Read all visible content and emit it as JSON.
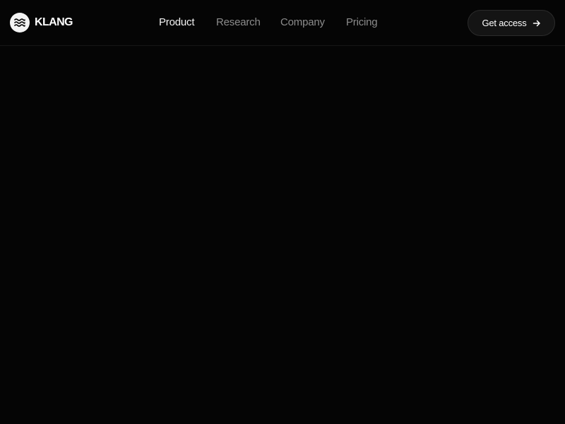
{
  "brand": {
    "name": "KLANG",
    "logo_icon": "waves-icon"
  },
  "nav": {
    "items": [
      {
        "label": "Product",
        "active": true
      },
      {
        "label": "Research",
        "active": false
      },
      {
        "label": "Company",
        "active": false
      },
      {
        "label": "Pricing",
        "active": false
      }
    ]
  },
  "cta": {
    "label": "Get access",
    "icon": "arrow-right-icon"
  },
  "colors": {
    "background": "#050505",
    "text_primary": "#f2f2f2",
    "text_muted": "#8c8c8c",
    "button_bg": "#141414",
    "logo_bg": "#f4f4f4"
  }
}
